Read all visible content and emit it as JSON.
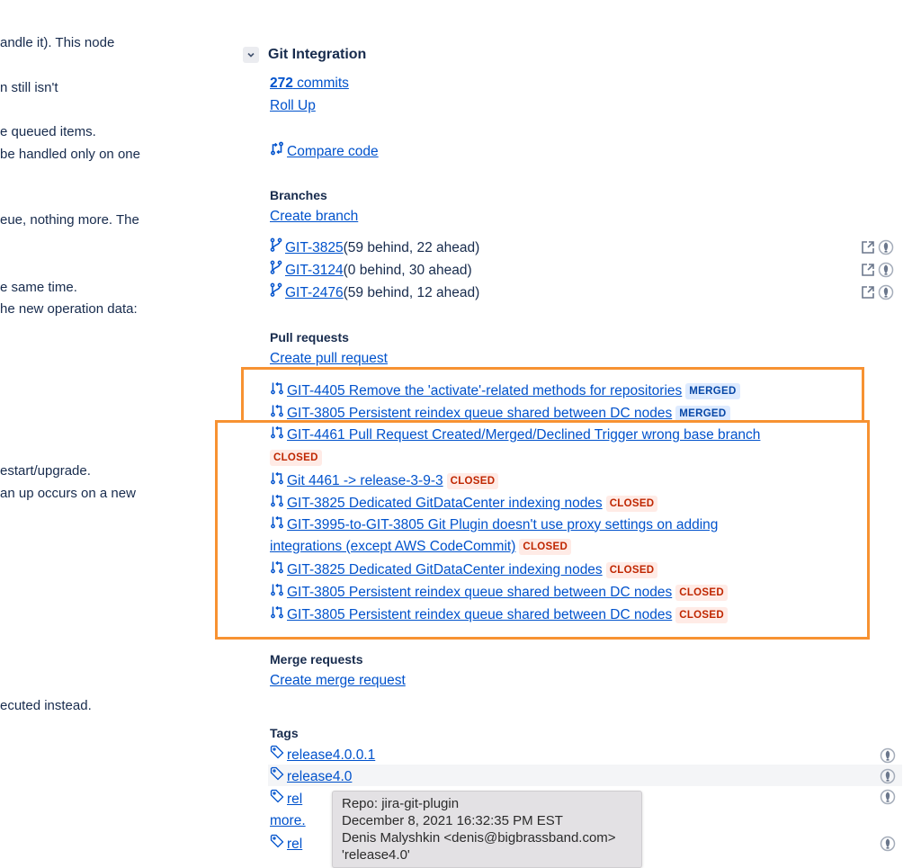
{
  "description": {
    "lines": [
      "andle it). This node",
      "n still isn't",
      "e queued items.",
      "be handled only on one",
      "eue, nothing more. The",
      "e same time.",
      "he new operation data:",
      "estart/upgrade.",
      "an up occurs on a new",
      "ecuted instead."
    ]
  },
  "git": {
    "section_title": "Git Integration",
    "commits_count": "272",
    "commits_label": " commits",
    "roll_up": "Roll Up",
    "compare_code": " Compare code",
    "branches": {
      "title": "Branches",
      "create": "Create branch",
      "items": [
        {
          "name": "GIT-3825",
          "info": " (59 behind, 22 ahead)"
        },
        {
          "name": "GIT-3124",
          "info": " (0 behind, 30 ahead)"
        },
        {
          "name": "GIT-2476",
          "info": " (59 behind, 12 ahead)"
        }
      ]
    },
    "pull_requests": {
      "title": "Pull requests",
      "create": "Create pull request",
      "items": [
        {
          "title": "GIT-4405 Remove the 'activate'-related methods for repositories ",
          "status": "MERGED"
        },
        {
          "title": "GIT-3805 Persistent reindex queue shared between DC nodes ",
          "status": "MERGED"
        },
        {
          "title": "GIT-4461 Pull Request Created/Merged/Declined Trigger wrong base branch ",
          "status": "CLOSED"
        },
        {
          "title": "Git 4461 -> release-3-9-3 ",
          "status": "CLOSED"
        },
        {
          "title": "GIT-3825 Dedicated GitDataCenter indexing nodes ",
          "status": "CLOSED"
        },
        {
          "title_line1": "GIT-3995-to-GIT-3805 Git Plugin doesn't use proxy settings on adding",
          "title_line2": "integrations (except AWS CodeCommit) ",
          "status": "CLOSED"
        },
        {
          "title": "GIT-3825 Dedicated GitDataCenter indexing nodes ",
          "status": "CLOSED"
        },
        {
          "title": "GIT-3805 Persistent reindex queue shared between DC nodes ",
          "status": "CLOSED"
        },
        {
          "title": "GIT-3805 Persistent reindex queue shared between DC nodes ",
          "status": "CLOSED"
        }
      ]
    },
    "merge_requests": {
      "title": "Merge requests",
      "create": "Create merge request"
    },
    "tags": {
      "title": "Tags",
      "items": [
        {
          "name": " release4.0.0.1"
        },
        {
          "name": " release4.0"
        },
        {
          "name": " rel"
        },
        {
          "name": " rel"
        }
      ],
      "more": "more."
    },
    "tooltip": {
      "repo": "Repo: jira-git-plugin",
      "date": "December 8, 2021 16:32:35 PM EST",
      "author": "Denis Malyshkin <denis@bigbrassband.com>",
      "tag": "'release4.0'"
    }
  },
  "colors": {
    "link": "#0052cc",
    "highlight_border": "#f79232",
    "merged_bg": "#deebff",
    "merged_text": "#0747a6",
    "closed_bg": "#ffebe6",
    "closed_text": "#bf2600"
  }
}
